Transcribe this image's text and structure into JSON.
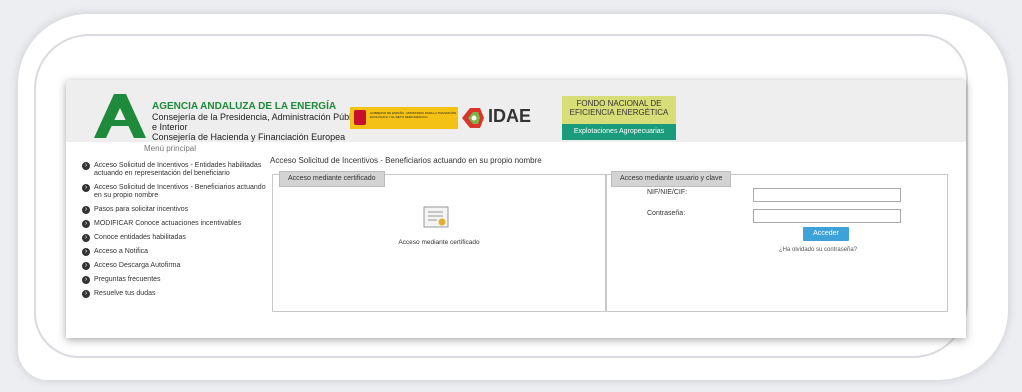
{
  "header": {
    "agency_name": "AGENCIA ANDALUZA DE LA ENERGÍA",
    "agency_line1": "Consejería de la Presidencia, Administración Pública",
    "agency_line2": "e Interior",
    "agency_line3": "Consejería de Hacienda y Financiación Europea",
    "gov_text": "GOBIERNO DE ESPAÑA · MINISTERIO PARA LA TRANSICIÓN ECOLÓGICA Y EL RETO DEMOGRÁFICO",
    "idae_label": "IDAE",
    "fondo_line1": "FONDO NACIONAL DE",
    "fondo_line2": "EFICIENCIA ENERGÉTICA",
    "fondo_sub": "Explotaciones Agropecuarias"
  },
  "menu": {
    "title": "Menú principal",
    "items": [
      "Acceso Solicitud de Incentivos - Entidades habilitadas actuando en representación del beneficiario",
      "Acceso Solicitud de Incentivos - Beneficiarios actuando en su propio nombre",
      "Pasos para solicitar incentivos",
      "MODIFICAR Conoce actuaciones incentivables",
      "Conoce entidades habilitadas",
      "Acceso a Notifica",
      "Acceso Descarga Autofirma",
      "Preguntas frecuentes",
      "Resuelve tus dudas"
    ]
  },
  "main": {
    "title": "Acceso Solicitud de Incentivos - Beneficiarios actuando en su propio nombre",
    "cert_tab": "Acceso mediante certificado",
    "cert_label": "Acceso mediante certificado",
    "user_tab": "Acceso mediante usuario y clave",
    "nif_label": "NIF/NIE/CIF:",
    "pass_label": "Contraseña:",
    "login_button": "Acceder",
    "forgot_link": "¿Ha olvidado su contraseña?"
  },
  "colors": {
    "agency_green": "#1e8a3b",
    "button_blue": "#3ea2d9",
    "fondo_yellow": "#d8de77",
    "fondo_teal": "#1a9c7c"
  }
}
